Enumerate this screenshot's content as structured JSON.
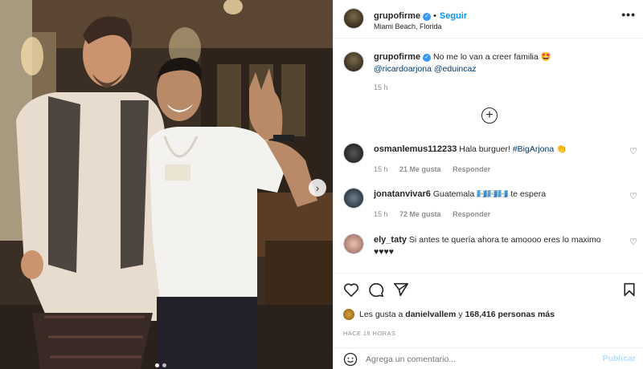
{
  "post": {
    "username": "grupofirme",
    "verified_glyph": "✓",
    "follow_label": "Seguir",
    "location": "Miami Beach, Florida",
    "more_glyph": "•••",
    "caption": {
      "username": "grupofirme",
      "text": "No me lo van a creer familia 🤩",
      "mentions": "@ricardoarjona @eduincaz",
      "age": "15 h"
    },
    "load_more_glyph": "+",
    "comments": [
      {
        "username": "osmanlemus112233",
        "text": "Hala burguer! ",
        "hashtag": "#BigArjona",
        "emoji": "👏",
        "age": "15 h",
        "likes": "21 Me gusta",
        "reply": "Responder"
      },
      {
        "username": "jonatanvivar6",
        "text": "Guatemala 🇬🇹🇬🇹🇬🇹 te espera",
        "age": "15 h",
        "likes": "72 Me gusta",
        "reply": "Responder"
      },
      {
        "username": "ely_taty",
        "text": "Si antes te quería ahora te amoooo eres lo maximo",
        "text2": "♥♥♥♥"
      }
    ],
    "likes_prefix": "Les gusta a ",
    "likes_user": "danielvallem",
    "likes_suffix": " y ",
    "likes_count": "168,416 personas más",
    "posted_ago": "HACE 16 HORAS",
    "comment_placeholder": "Agrega un comentario...",
    "publish_label": "Publicar",
    "carousel": {
      "next_glyph": "›",
      "slides": 2,
      "current": 0
    }
  },
  "icons": {
    "heart": "heart-icon",
    "comment": "comment-icon",
    "share": "share-icon",
    "save": "bookmark-icon",
    "emoji": "emoji-icon"
  },
  "colors": {
    "link": "#0095f6",
    "mention": "#00376b",
    "muted": "#8e8e8e",
    "publish_disabled": "#b2dffc"
  }
}
